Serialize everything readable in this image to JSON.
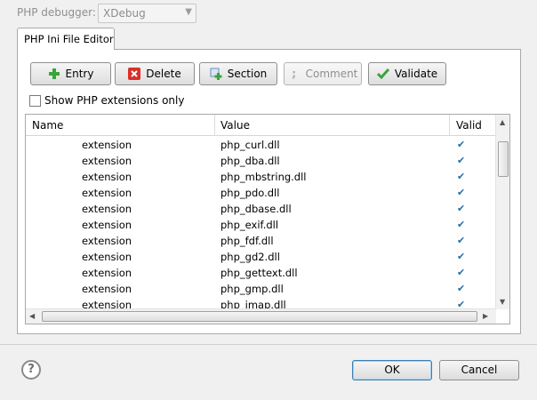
{
  "debugger": {
    "label": "PHP debugger:",
    "value": "XDebug"
  },
  "tab": {
    "label": "PHP Ini File Editor"
  },
  "toolbar": {
    "entry_label": "Entry",
    "delete_label": "Delete",
    "section_label": "Section",
    "comment_label": "Comment",
    "validate_label": "Validate"
  },
  "filter": {
    "show_extensions_label": "Show PHP extensions only",
    "checked": false
  },
  "table": {
    "columns": [
      "Name",
      "Value",
      "Valid"
    ],
    "rows": [
      {
        "name": "extension",
        "value": "php_curl.dll",
        "valid": "✔"
      },
      {
        "name": "extension",
        "value": "php_dba.dll",
        "valid": "✔"
      },
      {
        "name": "extension",
        "value": "php_mbstring.dll",
        "valid": "✔"
      },
      {
        "name": "extension",
        "value": "php_pdo.dll",
        "valid": "✔"
      },
      {
        "name": "extension",
        "value": "php_dbase.dll",
        "valid": "✔"
      },
      {
        "name": "extension",
        "value": "php_exif.dll",
        "valid": "✔"
      },
      {
        "name": "extension",
        "value": "php_fdf.dll",
        "valid": "✔"
      },
      {
        "name": "extension",
        "value": "php_gd2.dll",
        "valid": "✔"
      },
      {
        "name": "extension",
        "value": "php_gettext.dll",
        "valid": "✔"
      },
      {
        "name": "extension",
        "value": "php_gmp.dll",
        "valid": "✔"
      },
      {
        "name": "extension",
        "value": "php_imap.dll",
        "valid": "✔"
      }
    ]
  },
  "dialog": {
    "ok_label": "OK",
    "cancel_label": "Cancel"
  },
  "icons": {
    "add": "plus-icon",
    "delete": "red-x-icon",
    "section": "add-section-icon",
    "comment": "semicolon-icon",
    "validate": "green-check-icon",
    "help": "help-question-icon"
  },
  "colors": {
    "add_green": "#3aa53a",
    "delete_red": "#d9302b",
    "check_blue": "#2a6f9a",
    "ok_focus": "#3c7fb1"
  }
}
